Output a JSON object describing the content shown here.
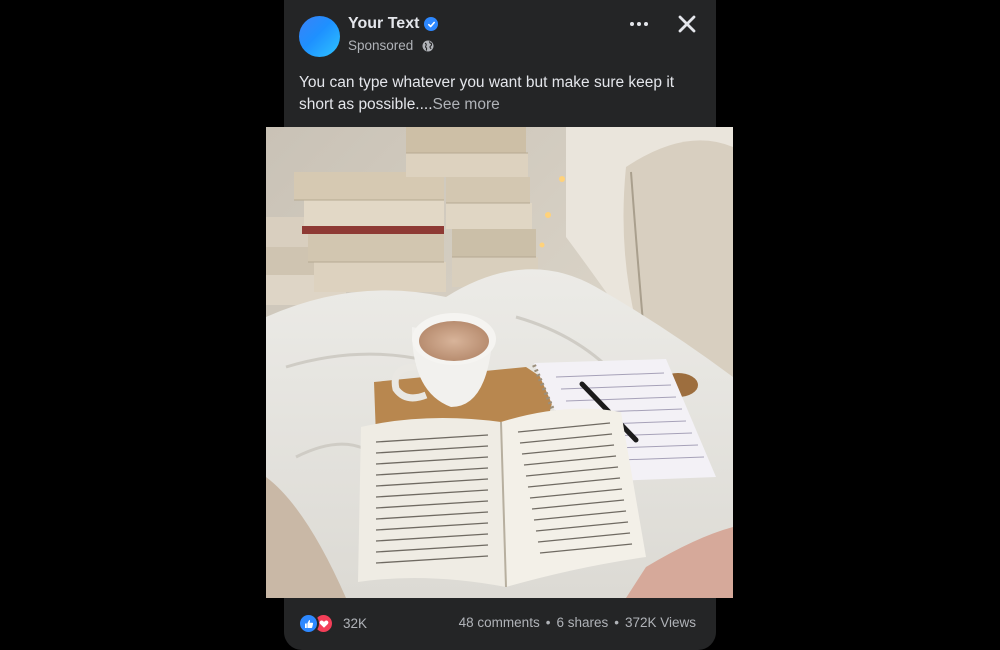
{
  "post": {
    "page_name": "Your Text",
    "sponsored_label": "Sponsored",
    "body_text": "You can type whatever you want but make sure keep it short as possible....",
    "see_more_label": "See more",
    "image_alt": "Open book, coffee mug, notebook and pencil on a white bed with stacked books and pillows"
  },
  "stats": {
    "reaction_count": "32K",
    "comments": "48 comments",
    "separator": "•",
    "shares": "6 shares",
    "views": "372K Views"
  },
  "icons": {
    "verified": "verified-badge-icon",
    "audience": "globe-icon",
    "more": "more-options-icon",
    "close": "close-icon",
    "like": "like-reaction-icon",
    "love": "love-reaction-icon"
  },
  "colors": {
    "card_background": "#242526",
    "primary_text": "#e4e6eb",
    "secondary_text": "#b0b3b8",
    "verified_blue": "#2d88ff",
    "love_red": "#f33e58"
  }
}
